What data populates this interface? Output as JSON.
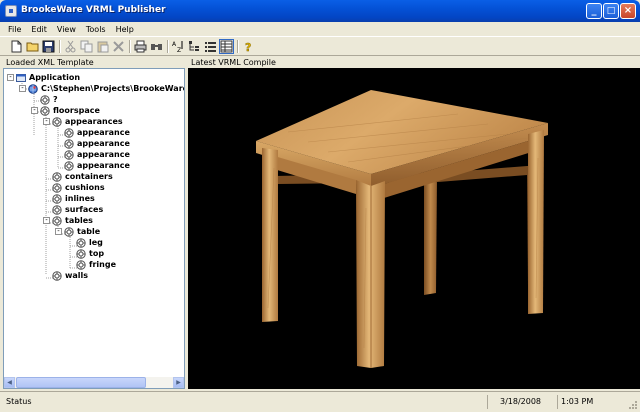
{
  "window": {
    "title": "BrookeWare VRML Publisher",
    "controls": [
      "_",
      "□",
      "×"
    ]
  },
  "menu": [
    "File",
    "Edit",
    "View",
    "Tools",
    "Help"
  ],
  "toolbar": {
    "buttons": [
      "new-file-icon",
      "open-folder-icon",
      "save-icon",
      "cut-icon",
      "copy-icon",
      "paste-icon",
      "delete-icon",
      "print-icon",
      "find-icon",
      "sort-az-icon",
      "tree-view-icon",
      "list-view-icon",
      "grid-view-icon",
      "help-icon"
    ]
  },
  "left_pane": {
    "header": "Loaded XML Template"
  },
  "right_pane": {
    "header": "Latest VRML Compile"
  },
  "tree": [
    {
      "label": "Application",
      "depth": 0,
      "expander": "-",
      "icon": "application-icon"
    },
    {
      "label": "C:\\Stephen\\Projects\\BrookeWare\\",
      "depth": 1,
      "expander": "-",
      "icon": "globe-icon"
    },
    {
      "label": "?",
      "depth": 2,
      "expander": "",
      "icon": "node-icon"
    },
    {
      "label": "floorspace",
      "depth": 2,
      "expander": "-",
      "icon": "node-icon"
    },
    {
      "label": "appearances",
      "depth": 3,
      "expander": "-",
      "icon": "node-icon"
    },
    {
      "label": "appearance",
      "depth": 4,
      "expander": "",
      "icon": "node-icon"
    },
    {
      "label": "appearance",
      "depth": 4,
      "expander": "",
      "icon": "node-icon"
    },
    {
      "label": "appearance",
      "depth": 4,
      "expander": "",
      "icon": "node-icon"
    },
    {
      "label": "appearance",
      "depth": 4,
      "expander": "",
      "icon": "node-icon"
    },
    {
      "label": "containers",
      "depth": 3,
      "expander": "",
      "icon": "node-icon"
    },
    {
      "label": "cushions",
      "depth": 3,
      "expander": "",
      "icon": "node-icon"
    },
    {
      "label": "inlines",
      "depth": 3,
      "expander": "",
      "icon": "node-icon"
    },
    {
      "label": "surfaces",
      "depth": 3,
      "expander": "",
      "icon": "node-icon"
    },
    {
      "label": "tables",
      "depth": 3,
      "expander": "-",
      "icon": "node-icon"
    },
    {
      "label": "table",
      "depth": 4,
      "expander": "-",
      "icon": "node-icon"
    },
    {
      "label": "leg",
      "depth": 5,
      "expander": "",
      "icon": "node-icon"
    },
    {
      "label": "top",
      "depth": 5,
      "expander": "",
      "icon": "node-icon"
    },
    {
      "label": "fringe",
      "depth": 5,
      "expander": "",
      "icon": "node-icon"
    },
    {
      "label": "walls",
      "depth": 3,
      "expander": "",
      "icon": "node-icon"
    }
  ],
  "status": {
    "text": "Status",
    "date": "3/18/2008",
    "time": "1:03 PM"
  },
  "colors": {
    "titlebar": "#0451d6",
    "viewport_bg": "#000000",
    "wood_light": "#e2b778",
    "wood_dark": "#8c5a2b"
  }
}
